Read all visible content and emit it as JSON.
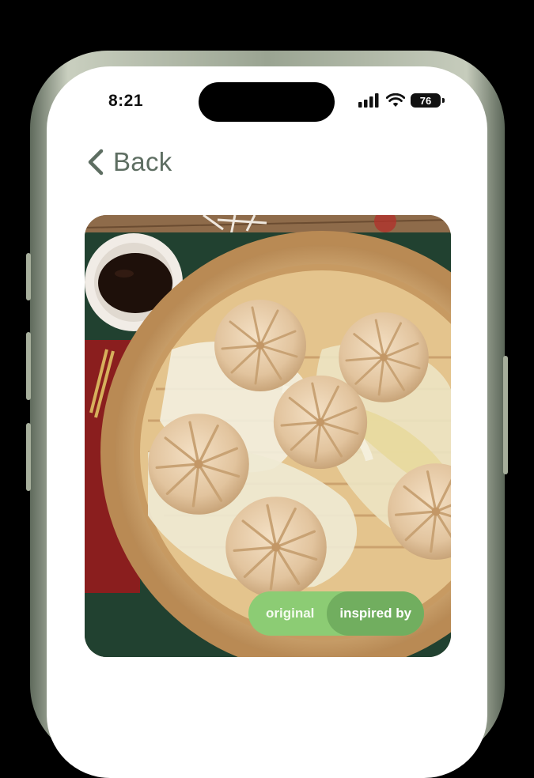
{
  "status_bar": {
    "time": "8:21",
    "battery_level": "76",
    "icons": [
      "signal-icon",
      "wifi-icon",
      "battery-icon"
    ]
  },
  "nav": {
    "back_label": "Back",
    "back_icon": "chevron-left-icon"
  },
  "photo": {
    "subject": "steamed soup dumplings in a bamboo steamer"
  },
  "toggle": {
    "options": [
      "original",
      "inspired by"
    ],
    "selected": "inspired by"
  },
  "colors": {
    "accent_green": "#8ccc74",
    "accent_green_active": "#71ae5f",
    "back_text": "#5e6e62"
  }
}
